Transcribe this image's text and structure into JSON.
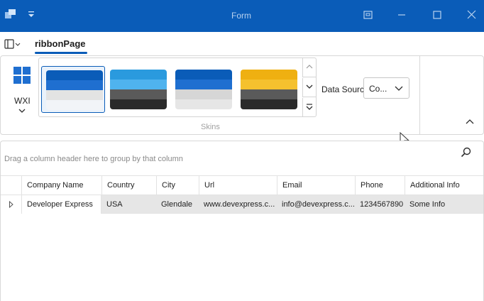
{
  "window": {
    "title": "Form",
    "colors": {
      "titlebar": "#0a5cb8",
      "accent": "#0a5cb8"
    }
  },
  "ribbon": {
    "page_tab": "ribbonPage",
    "skin_button": {
      "label": "WXI",
      "icon": "windows-logo-icon"
    },
    "skins_group": {
      "label": "Skins",
      "gallery": [
        {
          "name": "skin-blue",
          "colors": [
            "#0a5cb8",
            "#1f6fd0",
            "#e3e3e3",
            "#f2f4f8"
          ],
          "selected": true
        },
        {
          "name": "skin-light-blue",
          "colors": [
            "#2a9ade",
            "#4fb3ee",
            "#5a5a5a",
            "#2a2a2a"
          ],
          "selected": false
        },
        {
          "name": "skin-dark-blue",
          "colors": [
            "#0a5cb8",
            "#1f6fd0",
            "#d6d6d6",
            "#e6e6e6"
          ],
          "selected": false
        },
        {
          "name": "skin-yellow",
          "colors": [
            "#efb011",
            "#f5c12e",
            "#5a5a5a",
            "#2a2a2a"
          ],
          "selected": false
        }
      ]
    },
    "data_source": {
      "label": "Data Source",
      "value": "Co..."
    }
  },
  "grid": {
    "group_panel_hint": "Drag a column header here to group by that column",
    "columns": [
      "Company Name",
      "Country",
      "City",
      "Url",
      "Email",
      "Phone",
      "Additional Info"
    ],
    "rows": [
      [
        "Developer Express",
        "USA",
        "Glendale",
        "www.devexpress.c...",
        "info@devexpress.c...",
        "1234567890",
        "Some Info"
      ]
    ]
  }
}
